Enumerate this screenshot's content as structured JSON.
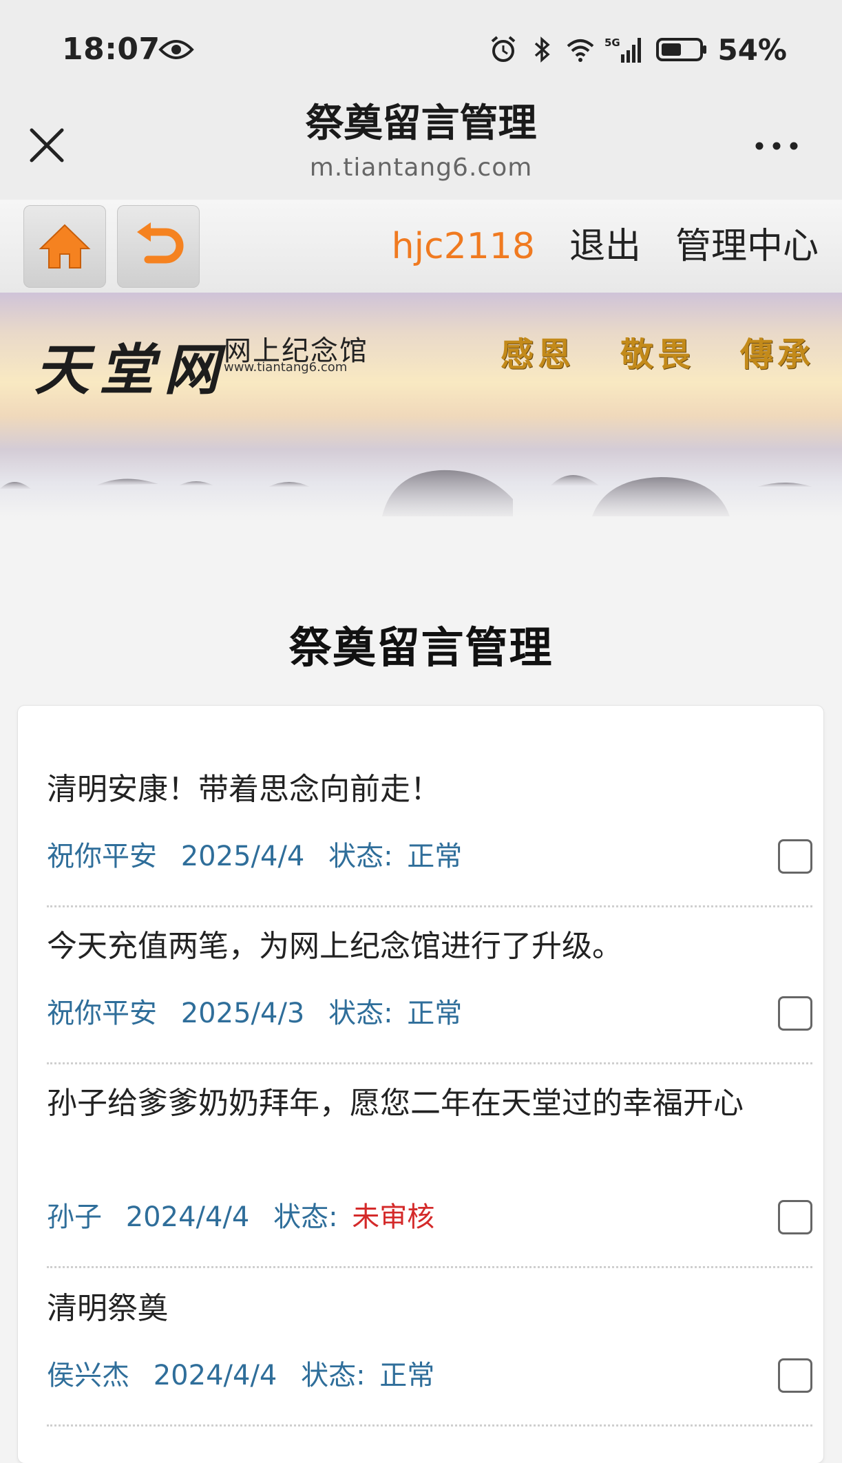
{
  "status_bar": {
    "time": "18:07",
    "battery_percent": "54%",
    "icons": [
      "eye-icon",
      "alarm-icon",
      "bluetooth-icon",
      "wifi-icon",
      "signal-5g-icon",
      "battery-icon"
    ]
  },
  "title_bar": {
    "title": "祭奠留言管理",
    "domain": "m.tiantang6.com"
  },
  "toolbar": {
    "username": "hjc2118",
    "logout": "退出",
    "admin_center": "管理中心"
  },
  "banner": {
    "logo": "天堂网",
    "subtitle": "网上纪念馆",
    "url": "www.tiantang6.com",
    "slogans": [
      "感恩",
      "敬畏",
      "傳承"
    ]
  },
  "heading": "祭奠留言管理",
  "messages": [
    {
      "text": "清明安康！带着思念向前走！",
      "name": "祝你平安",
      "date": "2025/4/4",
      "status_label": "状态:",
      "status": "正常",
      "checked": false
    },
    {
      "text": "今天充值两笔，为网上纪念馆进行了升级。",
      "name": "祝你平安",
      "date": "2025/4/3",
      "status_label": "状态:",
      "status": "正常",
      "checked": false
    },
    {
      "text": "孙子给爹爹奶奶拜年，愿您二年在天堂过的幸福开心",
      "name": "孙子",
      "date": "2024/4/4",
      "status_label": "状态:",
      "status": "未审核",
      "checked": false
    },
    {
      "text": "清明祭奠",
      "name": "侯兴杰",
      "date": "2024/4/4",
      "status_label": "状态:",
      "status": "正常",
      "checked": false
    }
  ],
  "colors": {
    "username": "#f07a20",
    "meta": "#2f6e9a",
    "status_pending": "#d42a2a",
    "home_icon": "#f58220"
  }
}
